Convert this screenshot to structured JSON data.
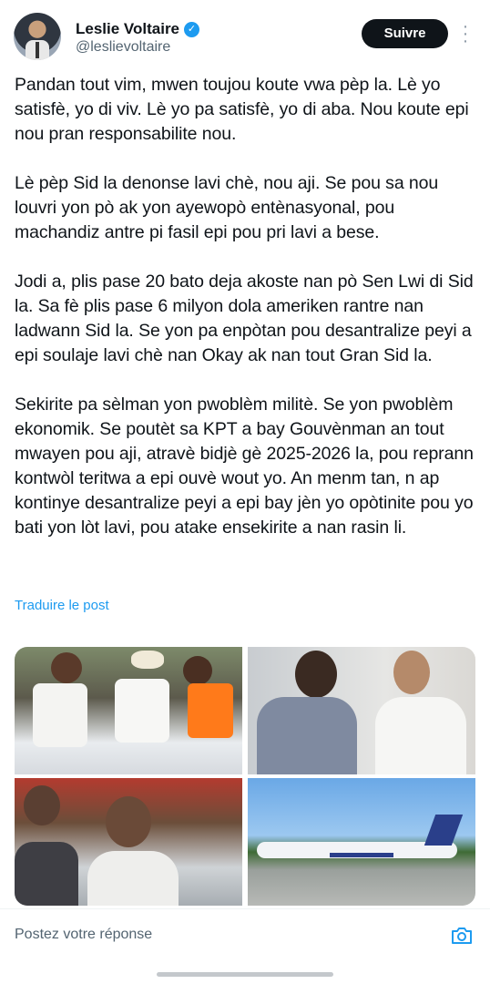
{
  "author": {
    "name": "Leslie Voltaire",
    "handle": "@leslievoltaire",
    "verified": true
  },
  "actions": {
    "follow_label": "Suivre",
    "more_icon": "more-vertical-icon"
  },
  "tweet": {
    "paragraphs": [
      "Pandan tout vim, mwen toujou koute vwa pèp la. Lè yo satisfè, yo di viv. Lè yo pa satisfè, yo di aba. Nou koute epi nou pran responsabilite nou.",
      "Lè pèp Sid la denonse lavi chè, nou aji. Se pou sa nou louvri yon pò ak yon ayewopò entènasyonal, pou machandiz antre pi fasil epi pou pri lavi a bese.",
      "Jodi a, plis pase 20 bato deja akoste nan pò Sen Lwi di Sid la. Sa fè plis pase 6 milyon dola ameriken rantre nan ladwann Sid la. Se yon pa enpòtan pou desantralize peyi a epi soulaje lavi chè nan Okay ak nan tout Gran Sid la.",
      "Sekirite pa sèlman yon pwoblèm militè. Se yon pwoblèm ekonomik. Se poutèt sa KPT a bay Gouvènman an tout mwayen pou aji, atravè bidjè gè 2025-2026 la, pou reprann kontwòl teritwa a epi ouvè wout yo. An menm tan, n ap kontinye desantralize peyi a epi bay jèn yo opòtinite pou yo bati yon lòt lavi, pou atake ensekirite a nan rasin li."
    ],
    "translate_label": "Traduire le post"
  },
  "reply": {
    "placeholder": "Postez votre réponse",
    "camera_icon": "camera-icon"
  },
  "colors": {
    "accent": "#1d9bf0",
    "text": "#0f1419",
    "secondary": "#536471",
    "button_bg": "#0f1419"
  }
}
